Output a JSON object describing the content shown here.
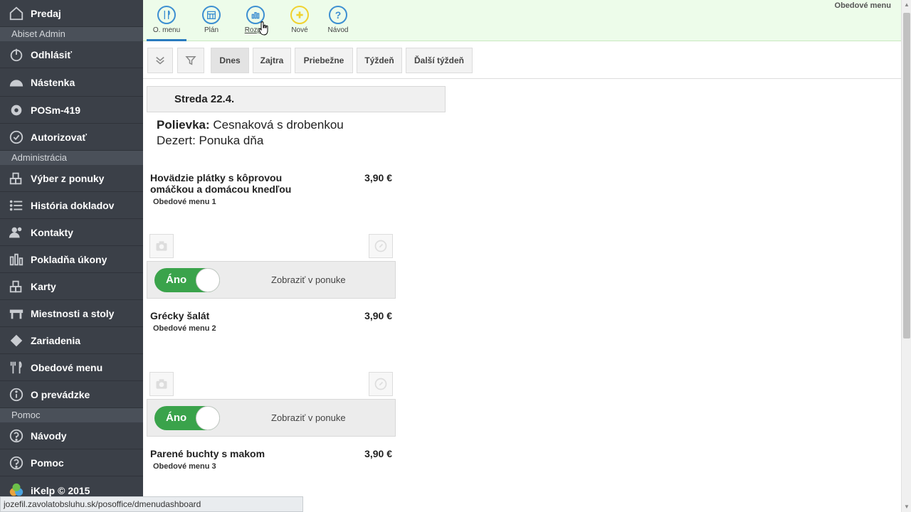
{
  "sidebar": {
    "top_item": "Predaj",
    "section_user": "Abiset Admin",
    "user_items": [
      "Odhlásiť",
      "Nástenka",
      "POSm-419",
      "Autorizovať"
    ],
    "section_admin": "Administrácia",
    "admin_items": [
      "Výber z ponuky",
      "História dokladov",
      "Kontakty",
      "Pokladňa úkony",
      "Karty",
      "Miestnosti a stoly",
      "Zariadenia",
      "Obedové menu",
      "O prevádzke"
    ],
    "section_help": "Pomoc",
    "help_items": [
      "Návody",
      "Pomoc"
    ],
    "footer": "iKelp © 2015"
  },
  "toolbar": {
    "buttons": [
      "O. menu",
      "Plán",
      "Rozpis",
      "Nové",
      "Návod"
    ],
    "page_title": "Obedové menu"
  },
  "filters": {
    "buttons": [
      "Dnes",
      "Zajtra",
      "Priebežne",
      "Týždeň",
      "Ďalší týždeň"
    ],
    "selected": "Dnes"
  },
  "day": {
    "header": "Streda 22.4.",
    "soup_label": "Polievka:",
    "soup_value": "Cesnaková s drobenkou",
    "dessert_label": "Dezert:",
    "dessert_value": "Ponuka dňa"
  },
  "meals": [
    {
      "name": "Hovädzie plátky s kôprovou omáčkou a domácou knedľou",
      "price": "3,90 €",
      "menu": "Obedové menu 1",
      "toggle": "Áno",
      "toggle_text": "Zobraziť v ponuke"
    },
    {
      "name": "Grécky šalát",
      "price": "3,90 €",
      "menu": "Obedové menu 2",
      "toggle": "Áno",
      "toggle_text": "Zobraziť v ponuke"
    },
    {
      "name": "Parené buchty s makom",
      "price": "3,90 €",
      "menu": "Obedové menu 3"
    }
  ],
  "status_url": "jozefil.zavolatobsluhu.sk/posoffice/dmenudashboard",
  "colors": {
    "sidebar_bg": "#3b4048",
    "toolbar_bg": "#edfcea",
    "toggle_on": "#3aa34b",
    "accent": "#3d8fd1"
  }
}
